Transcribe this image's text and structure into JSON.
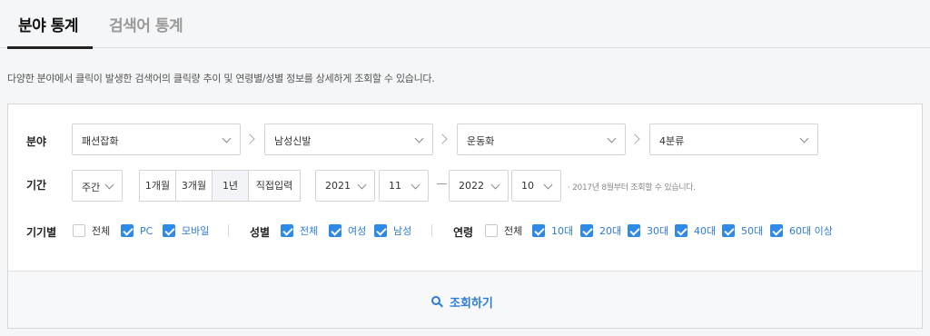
{
  "tabs": [
    {
      "label": "분야 통계",
      "active": true
    },
    {
      "label": "검색어 통계",
      "active": false
    }
  ],
  "description": "다양한 분야에서 클릭이 발생한 검색어의 클릭량 추이 및 연령별/성별 정보를 상세하게 조회할 수 있습니다.",
  "category": {
    "label": "분야",
    "levels": [
      "패션잡화",
      "남성신발",
      "운동화",
      "4분류"
    ]
  },
  "period": {
    "label": "기간",
    "unit": "주간",
    "ranges": [
      "1개월",
      "3개월",
      "1년",
      "직접입력"
    ],
    "active_range": "1년",
    "start_year": "2021",
    "start_month": "11",
    "end_year": "2022",
    "end_month": "10",
    "hint": "· 2017년 8월부터 조회할 수 있습니다."
  },
  "device": {
    "label": "기기별",
    "options": [
      {
        "label": "전체",
        "checked": false
      },
      {
        "label": "PC",
        "checked": true
      },
      {
        "label": "모바일",
        "checked": true
      }
    ]
  },
  "gender": {
    "label": "성별",
    "options": [
      {
        "label": "전체",
        "checked": true
      },
      {
        "label": "여성",
        "checked": true
      },
      {
        "label": "남성",
        "checked": true
      }
    ]
  },
  "age": {
    "label": "연령",
    "options": [
      {
        "label": "전체",
        "checked": false
      },
      {
        "label": "10대",
        "checked": true
      },
      {
        "label": "20대",
        "checked": true
      },
      {
        "label": "30대",
        "checked": true
      },
      {
        "label": "40대",
        "checked": true
      },
      {
        "label": "50대",
        "checked": true
      },
      {
        "label": "60대 이상",
        "checked": true
      }
    ]
  },
  "search_button": {
    "label": "조회하기",
    "icon": "search-icon"
  },
  "colors": {
    "accent": "#2e8ae6",
    "link": "#2e7bd6"
  }
}
